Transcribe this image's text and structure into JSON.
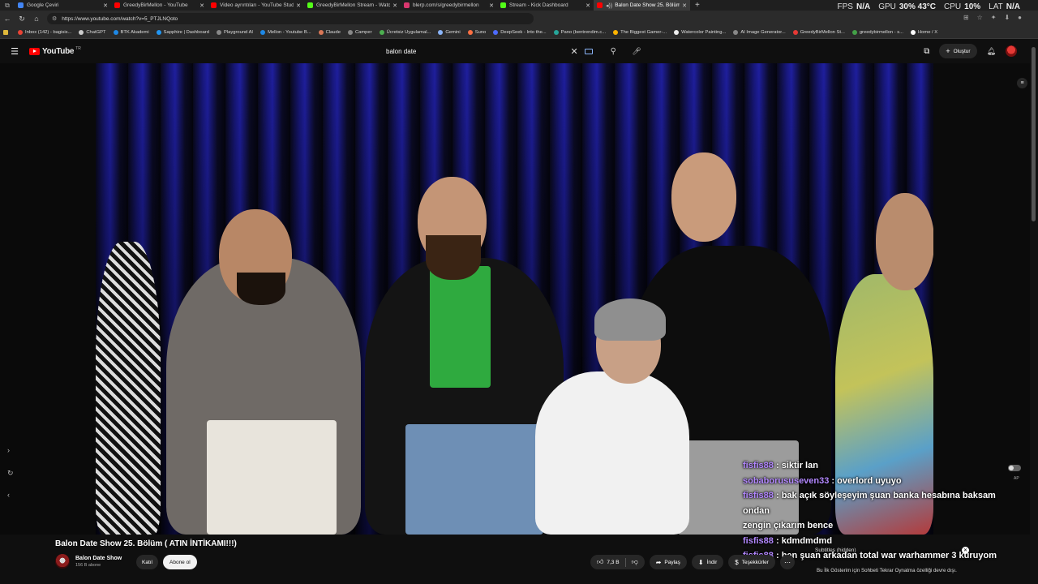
{
  "tabs": [
    {
      "title": "Google Çeviri",
      "color": "#4285f4"
    },
    {
      "title": "GreedyBirMellon - YouTube",
      "color": "#ff0000"
    },
    {
      "title": "Video ayrıntıları - YouTube Studio",
      "color": "#ff0000"
    },
    {
      "title": "GreedyBirMellon Stream - Watch",
      "color": "#53fc18"
    },
    {
      "title": "blerp.com/s/greedybirmellon",
      "color": "#d9376e"
    },
    {
      "title": "Stream - Kick Dashboard",
      "color": "#53fc18"
    },
    {
      "title": "Balon Date Show 25. Bölüm",
      "color": "#ff0000"
    }
  ],
  "hud": {
    "fps_label": "FPS",
    "fps": "N/A",
    "gpu_label": "GPU",
    "gpu": "30% 43°C",
    "cpu_label": "CPU",
    "cpu": "10%",
    "lat_label": "LAT",
    "lat": "N/A"
  },
  "address": {
    "url": "https://www.youtube.com/watch?v=5_PTJLNQoto"
  },
  "bookmarks": [
    {
      "label": "Inbox (142) - bagisis...",
      "color": "#ea4335"
    },
    {
      "label": "ChatGPT",
      "color": "#cccccc"
    },
    {
      "label": "BTK Akademi",
      "color": "#1e88e5"
    },
    {
      "label": "Sapphire | Dashboard",
      "color": "#2196f3"
    },
    {
      "label": "Playground AI",
      "color": "#888888"
    },
    {
      "label": "Mellon - Youtube B...",
      "color": "#1e88e5"
    },
    {
      "label": "Claude",
      "color": "#d97757"
    },
    {
      "label": "Camper",
      "color": "#888888"
    },
    {
      "label": "Ücretsiz Uygulamal...",
      "color": "#4caf50"
    },
    {
      "label": "Gemini",
      "color": "#8ab4f8"
    },
    {
      "label": "Suno",
      "color": "#ff7043"
    },
    {
      "label": "DeepSeek - Into the...",
      "color": "#4d6bfe"
    },
    {
      "label": "Pano (bentrendim.c...",
      "color": "#26a69a"
    },
    {
      "label": "The Biggest Gamer-...",
      "color": "#ffb300"
    },
    {
      "label": "Watercolor Painting...",
      "color": "#eeeeee"
    },
    {
      "label": "AI Image Generator...",
      "color": "#888888"
    },
    {
      "label": "GreedyBirMellon St...",
      "color": "#e53935"
    },
    {
      "label": "greedybirmellon - s...",
      "color": "#43a047"
    },
    {
      "label": "Home / X",
      "color": "#ffffff"
    }
  ],
  "header": {
    "logo_text": "YouTube",
    "country": "TR",
    "search_query": "balon date",
    "create_label": "Oluştur"
  },
  "chat": [
    {
      "user": "fisfis88",
      "message": "siktir lan"
    },
    {
      "user": "sobaborususeven33",
      "message": "overlord uyuyo"
    },
    {
      "user": "fisfis88",
      "message": "bak açık söyleşeyim şuan banka hesabına baksam ondan"
    },
    {
      "user": "",
      "message": "zengin çıkarım bence"
    },
    {
      "user": "fisfis88",
      "message": "kdmdmdmd"
    },
    {
      "user": "fisfis88",
      "message": "ben şuan arkadan total war warhammer 3 kuruyom"
    }
  ],
  "player": {
    "subtitles": "Subtitles (hidden)",
    "autoplay_label": "AP"
  },
  "video": {
    "title": "Balon Date Show 25. Bölüm ( ATIN İNTİKAMI!!!)",
    "channel": "Balon Date Show",
    "subscribers": "156 B abone",
    "join_label": "Katıl",
    "subscribe_label": "Abone ol",
    "likes": "7,3 B",
    "share_label": "Paylaş",
    "download_label": "İndir",
    "thanks_label": "Teşekkürler"
  },
  "chat_banner": "Bu İlk Gösterim için Sohbeti Tekrar Oynatma özelliği devre dışı."
}
